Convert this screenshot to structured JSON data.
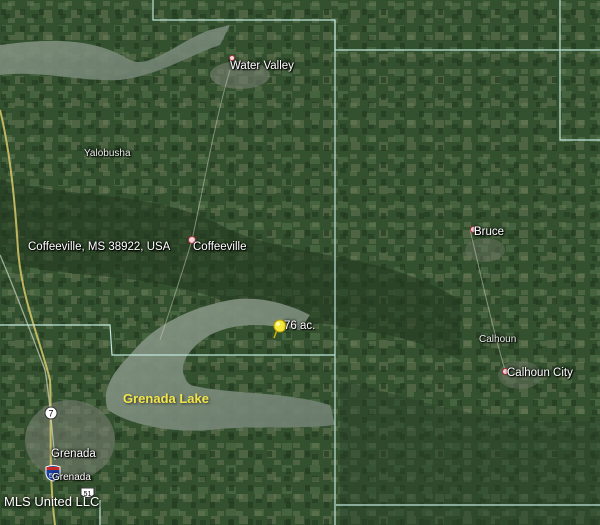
{
  "map": {
    "places": {
      "water_valley": "Water Valley",
      "yalobusha": "Yalobusha",
      "coffeeville_address": "Coffeeville, MS 38922, USA",
      "coffeeville": "Coffeeville",
      "bruce": "Bruce",
      "calhoun": "Calhoun",
      "calhoun_city": "Calhoun City",
      "grenada": "Grenada",
      "grenada_small": "Grenada"
    },
    "lake": "Grenada Lake",
    "parcel_label": "76 ac.",
    "highway_shields": {
      "route7": "7",
      "route51": "51",
      "interstate55": "55"
    },
    "credit": "MLS United LLC",
    "colors": {
      "boundary": "#bfe6dc",
      "lake_label": "#f2e64a",
      "pin": "#f7e93a",
      "forest": "#2f4a2c"
    }
  }
}
